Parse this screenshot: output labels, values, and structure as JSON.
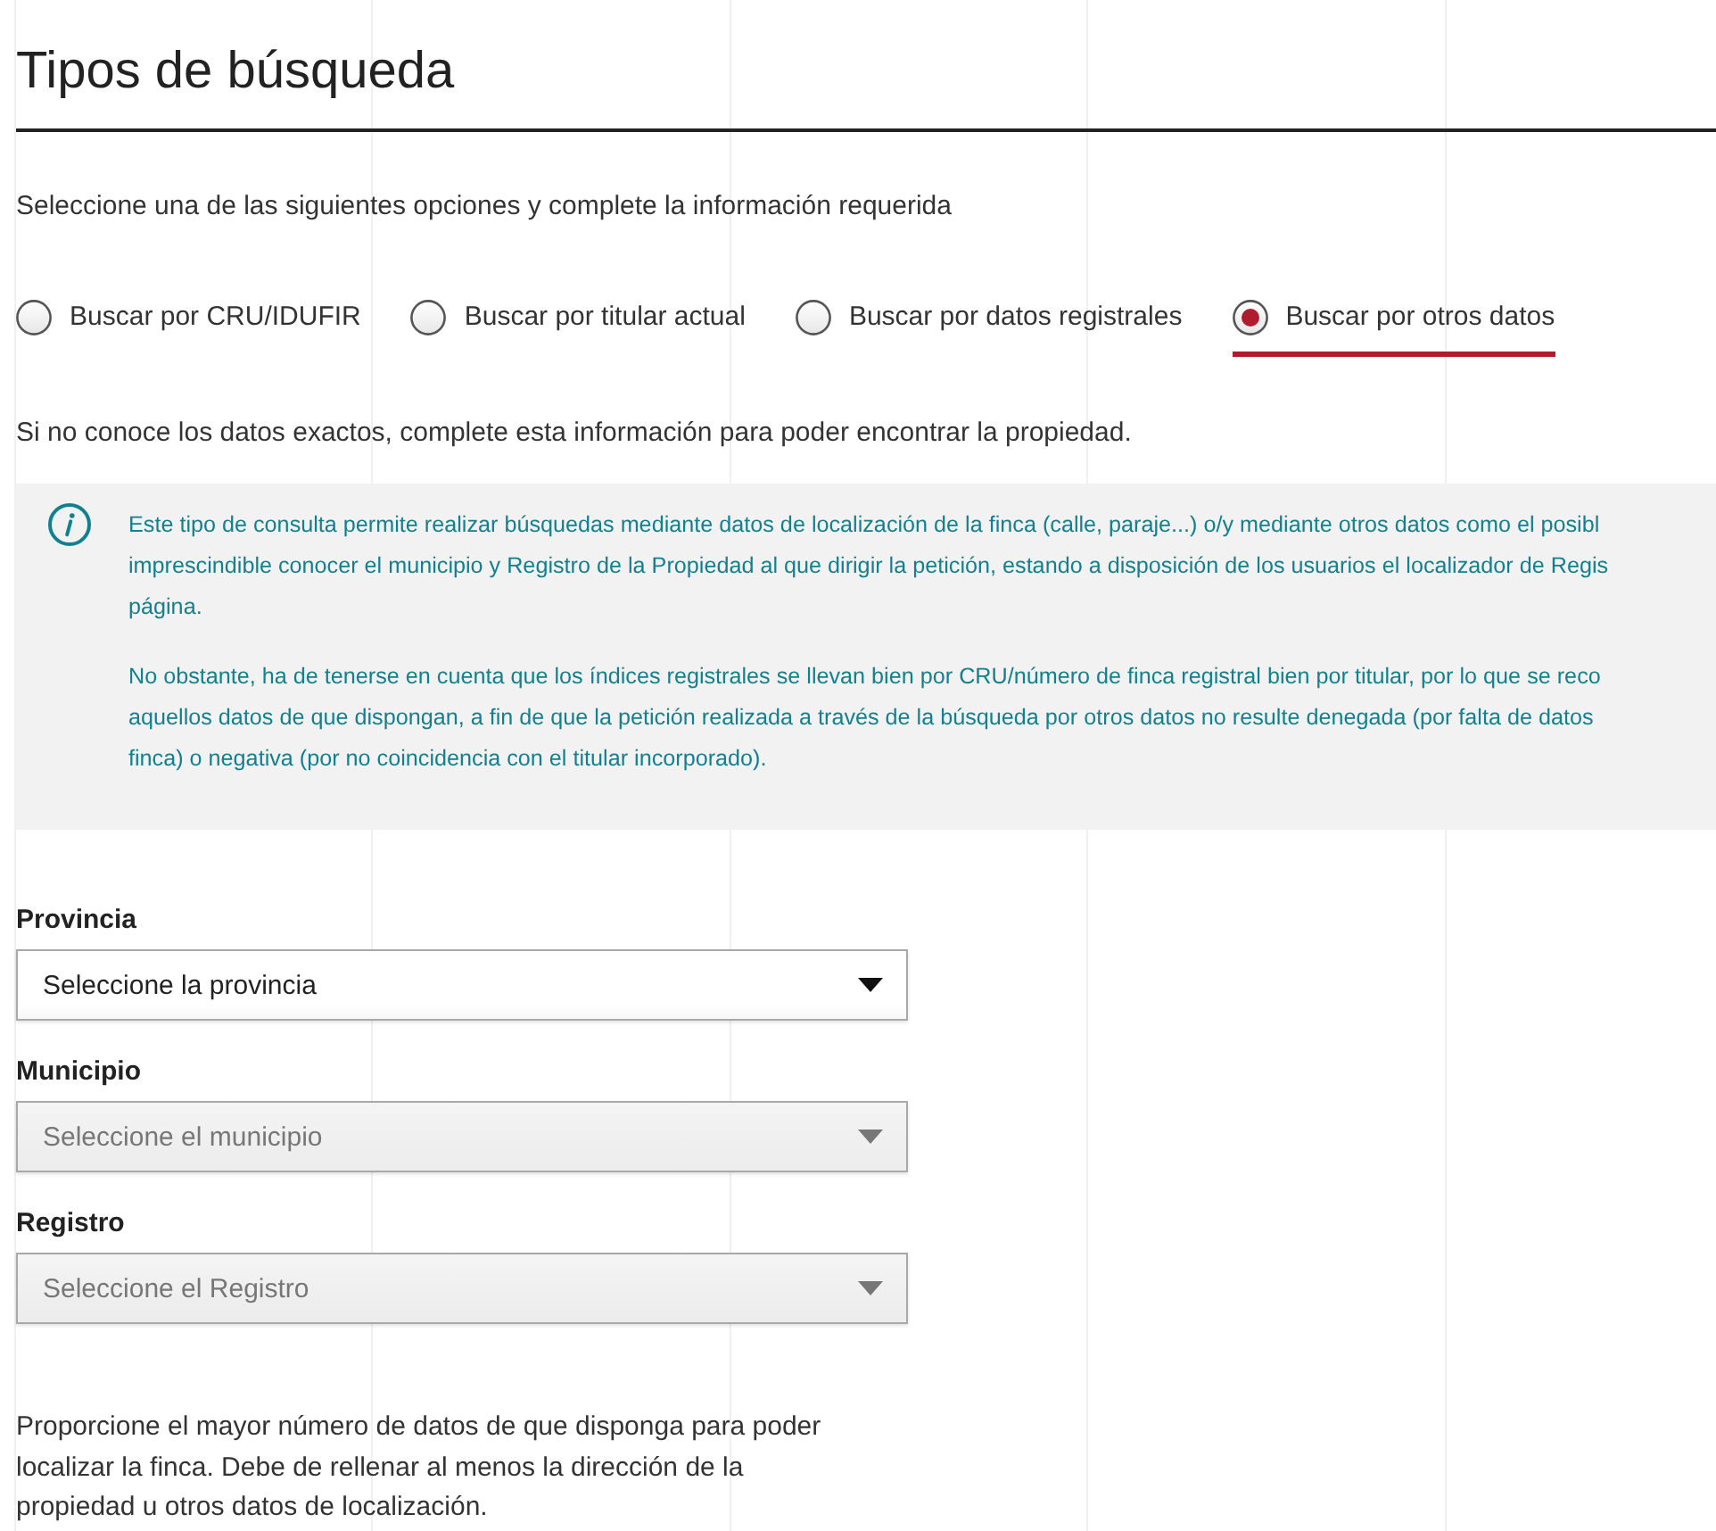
{
  "title": "Tipos de búsqueda",
  "instruction": "Seleccione una de las siguientes opciones y complete la información requerida",
  "search_types": [
    {
      "label": "Buscar por CRU/IDUFIR",
      "selected": false
    },
    {
      "label": "Buscar por titular actual",
      "selected": false
    },
    {
      "label": "Buscar por datos registrales",
      "selected": false
    },
    {
      "label": "Buscar por otros datos",
      "selected": true
    }
  ],
  "hint": "Si no conoce los datos exactos, complete esta información para poder encontrar la propiedad.",
  "info_box": {
    "paragraphs": [
      [
        "Este tipo de consulta permite realizar búsquedas mediante datos de localización de la finca (calle, paraje...) o/y mediante otros datos como el posibl",
        "imprescindible conocer el municipio y Registro de la Propiedad al que dirigir la petición, estando a disposición de los usuarios el localizador de Regis",
        "página."
      ],
      [
        "No obstante, ha de tenerse en cuenta que los índices registrales se llevan bien por CRU/número de finca registral bien por titular, por lo que se reco",
        "aquellos datos de que dispongan, a fin de que la petición realizada a través de la búsqueda por otros datos no resulte denegada (por falta de datos",
        "finca) o negativa (por no coincidencia con el titular incorporado)."
      ]
    ]
  },
  "fields": [
    {
      "label": "Provincia",
      "placeholder": "Seleccione la provincia",
      "disabled": false
    },
    {
      "label": "Municipio",
      "placeholder": "Seleccione el municipio",
      "disabled": true
    },
    {
      "label": "Registro",
      "placeholder": "Seleccione el Registro",
      "disabled": true
    }
  ],
  "note": "Proporcione el mayor número de datos de que disponga para poder localizar la finca. Debe de rellenar al menos la dirección de la propiedad u otros datos de localización."
}
